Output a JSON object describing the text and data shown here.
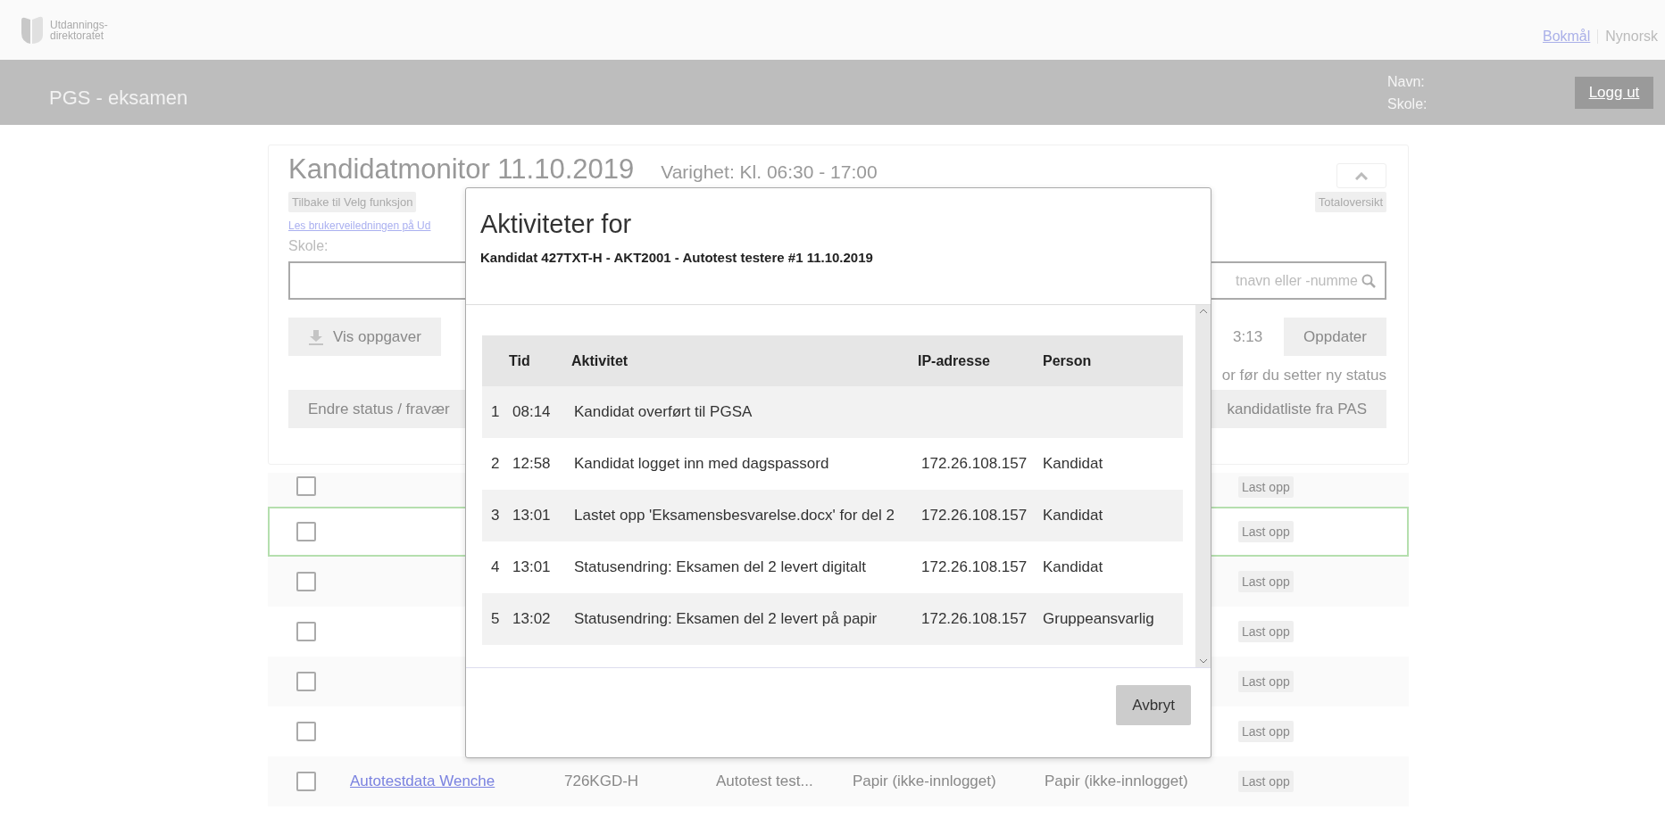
{
  "header": {
    "logo_lines": [
      "Utdannings-",
      "direktoratet"
    ],
    "languages": [
      {
        "label": "Bokmål",
        "selected": true
      },
      {
        "label": "Nynorsk",
        "selected": false
      }
    ],
    "app_title": "PGS - eksamen",
    "user_labels": [
      "Navn:",
      "Skole:"
    ],
    "logout": "Logg ut"
  },
  "monitor": {
    "title": "Kandidatmonitor 11.10.2019",
    "duration": "Varighet: Kl. 06:30 - 17:00",
    "back_link": "Tilbake til Velg funksjon",
    "overview": "Totaloversikt",
    "guide_link": "Les brukerveiledningen på Ud",
    "school_label": "Skole:",
    "search_placeholder": "tnavn eller -numme",
    "show_tasks": "Vis oppgaver",
    "time": "3:13",
    "refresh": "Oppdater",
    "hint": "or før du setter ny status",
    "change_status": "Endre status / fravær",
    "import": "kandidatliste fra PAS"
  },
  "candidates": [
    {
      "checked": false,
      "highlighted": false,
      "upload": "Last opp"
    },
    {
      "checked": false,
      "highlighted": true,
      "upload": "Last opp"
    },
    {
      "checked": false,
      "highlighted": false,
      "upload": "Last opp"
    },
    {
      "checked": false,
      "highlighted": false,
      "upload": "Last opp"
    },
    {
      "checked": false,
      "highlighted": false,
      "upload": "Last opp"
    },
    {
      "checked": false,
      "highlighted": false,
      "upload": "Last opp"
    },
    {
      "checked": false,
      "highlighted": false,
      "name": "Autotestdata Wenche",
      "number": "726KGD-H",
      "exam": "Autotest test...",
      "status": "Papir (ikke-innlogget)",
      "status_2": "Papir (ikke-innlogget)",
      "upload": "Last opp"
    }
  ],
  "modal": {
    "title": "Aktiviteter for",
    "subtitle": "Kandidat 427TXT-H - AKT2001 - Autotest testere #1 11.10.2019",
    "columns": [
      "Tid",
      "Aktivitet",
      "IP-adresse",
      "Person"
    ],
    "rows": [
      {
        "index": "1",
        "time": "08:14",
        "activity": "Kandidat overført til PGSA"
      },
      {
        "index": "2",
        "time": "12:58",
        "activity": "Kandidat logget inn med dagspassord",
        "ip": "172.26.108.157",
        "person": "Kandidat"
      },
      {
        "index": "3",
        "time": "13:01",
        "activity": "Lastet opp 'Eksamensbesvarelse.docx' for del 2",
        "ip": "172.26.108.157",
        "person": "Kandidat"
      },
      {
        "index": "4",
        "time": "13:01",
        "activity": "Statusendring: Eksamen del 2 levert digitalt",
        "ip": "172.26.108.157",
        "person": "Kandidat"
      },
      {
        "index": "5",
        "time": "13:02",
        "activity": "Statusendring: Eksamen del 2 levert på papir",
        "ip": "172.26.108.157",
        "person": "Gruppeansvarlig"
      }
    ],
    "cancel": "Avbryt"
  }
}
